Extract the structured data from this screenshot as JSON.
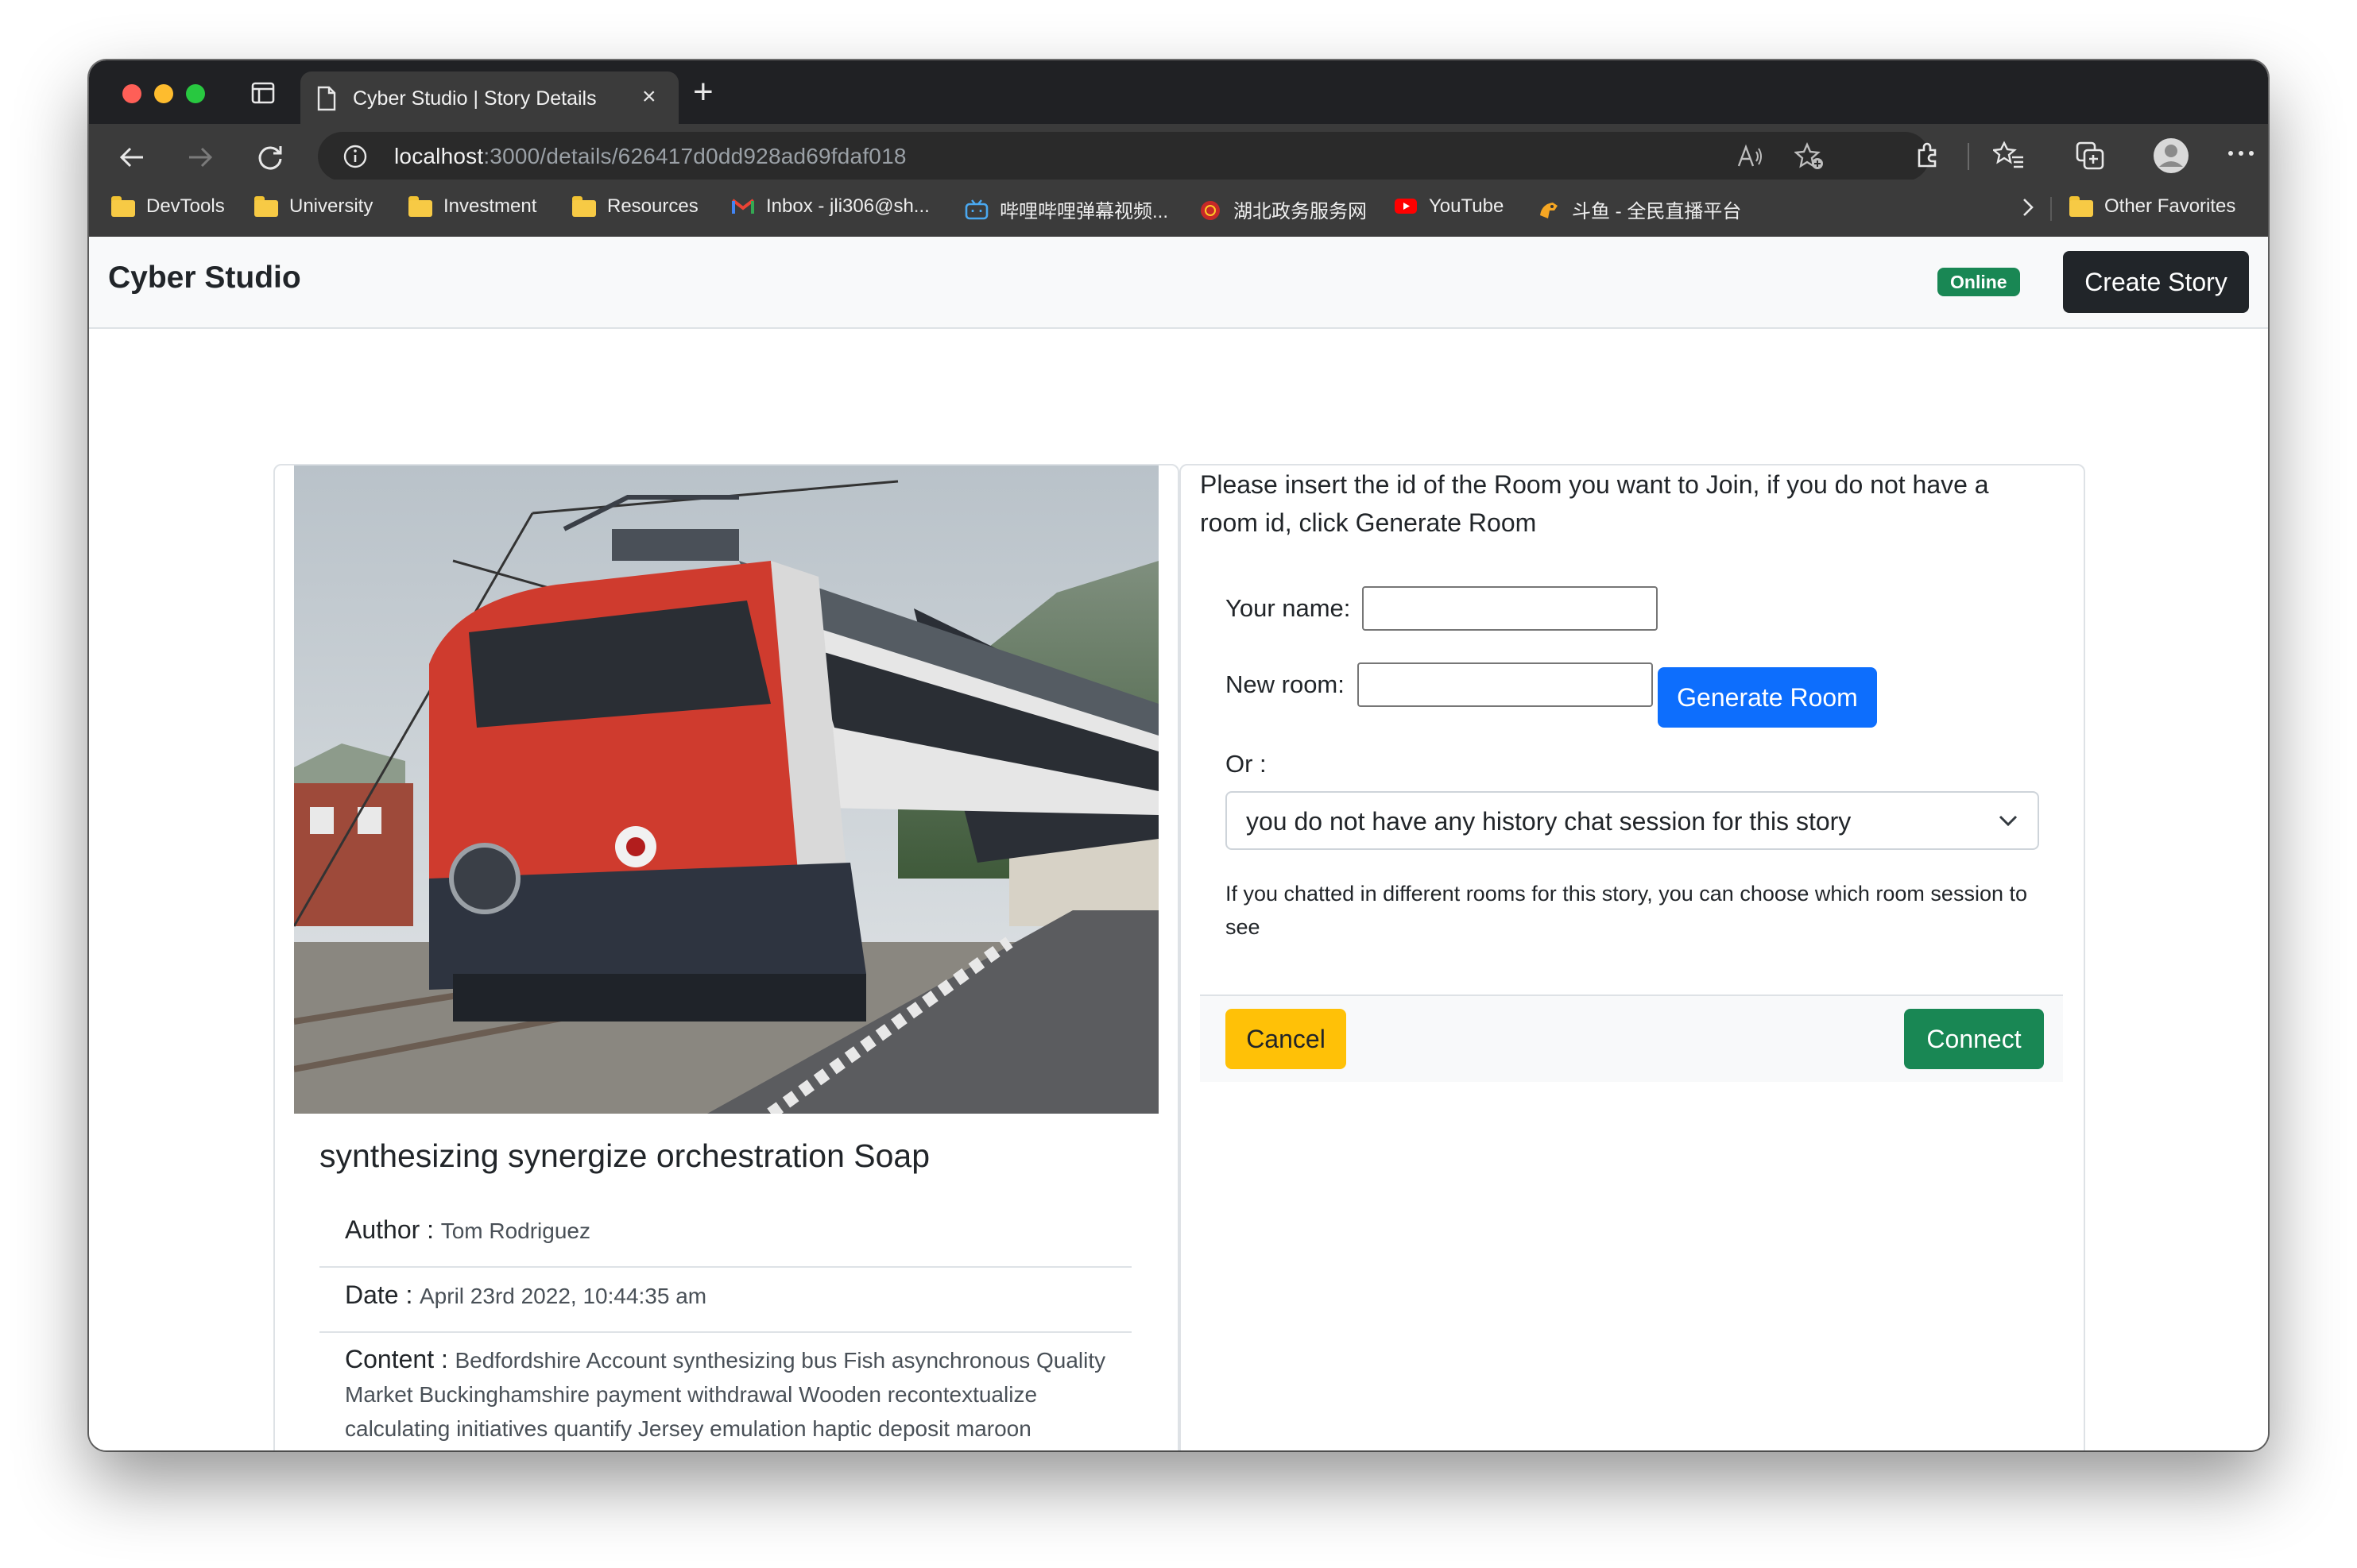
{
  "browser": {
    "tab_title": "Cyber Studio | Story Details",
    "url_host": "localhost",
    "url_rest": ":3000/details/626417d0dd928ad69fdaf018",
    "bookmarks": [
      {
        "label": "DevTools",
        "icon": "folder-icon"
      },
      {
        "label": "University",
        "icon": "folder-icon"
      },
      {
        "label": "Investment",
        "icon": "folder-icon"
      },
      {
        "label": "Resources",
        "icon": "folder-icon"
      },
      {
        "label": "Inbox - jli306@sh...",
        "icon": "gmail-icon"
      },
      {
        "label": "哔哩哔哩弹幕视频...",
        "icon": "bilibili-icon"
      },
      {
        "label": "湖北政务服务网",
        "icon": "hubei-gov-icon"
      },
      {
        "label": "YouTube",
        "icon": "youtube-icon"
      },
      {
        "label": "斗鱼 - 全民直播平台",
        "icon": "douyu-icon"
      }
    ],
    "other_favorites": "Other Favorites"
  },
  "navbar": {
    "brand": "Cyber Studio",
    "status_badge": "Online",
    "create_story": "Create Story"
  },
  "story": {
    "title": "synthesizing synergize orchestration Soap",
    "author_label": "Author :",
    "author": "Tom Rodriguez",
    "date_label": "Date :",
    "date": "April 23rd 2022, 10:44:35 am",
    "content_label": "Content :",
    "content": "Bedfordshire Account synthesizing bus Fish asynchronous Quality Market Buckinghamshire payment withdrawal Wooden recontextualize calculating initiatives quantify Jersey emulation haptic deposit maroon Automotive Coves withdrawal hacking innovate Forward Beauty encoding Outdoors compress relationships Implemented Group"
  },
  "join": {
    "intro": "Please insert the id of the Room you want to Join, if you do not have a room id, click Generate Room",
    "name_label": "Your name:",
    "name_value": "",
    "room_label": "New room:",
    "room_value": "",
    "generate_button": "Generate Room",
    "or_label": "Or :",
    "history_selected": "you do not have any history chat session for this story",
    "help_text": "If you chatted in different rooms for this story, you can choose which room session to see",
    "cancel_button": "Cancel",
    "connect_button": "Connect"
  },
  "colors": {
    "primary": "#0d6efd",
    "success": "#198754",
    "warning": "#ffc107",
    "dark": "#212529"
  }
}
